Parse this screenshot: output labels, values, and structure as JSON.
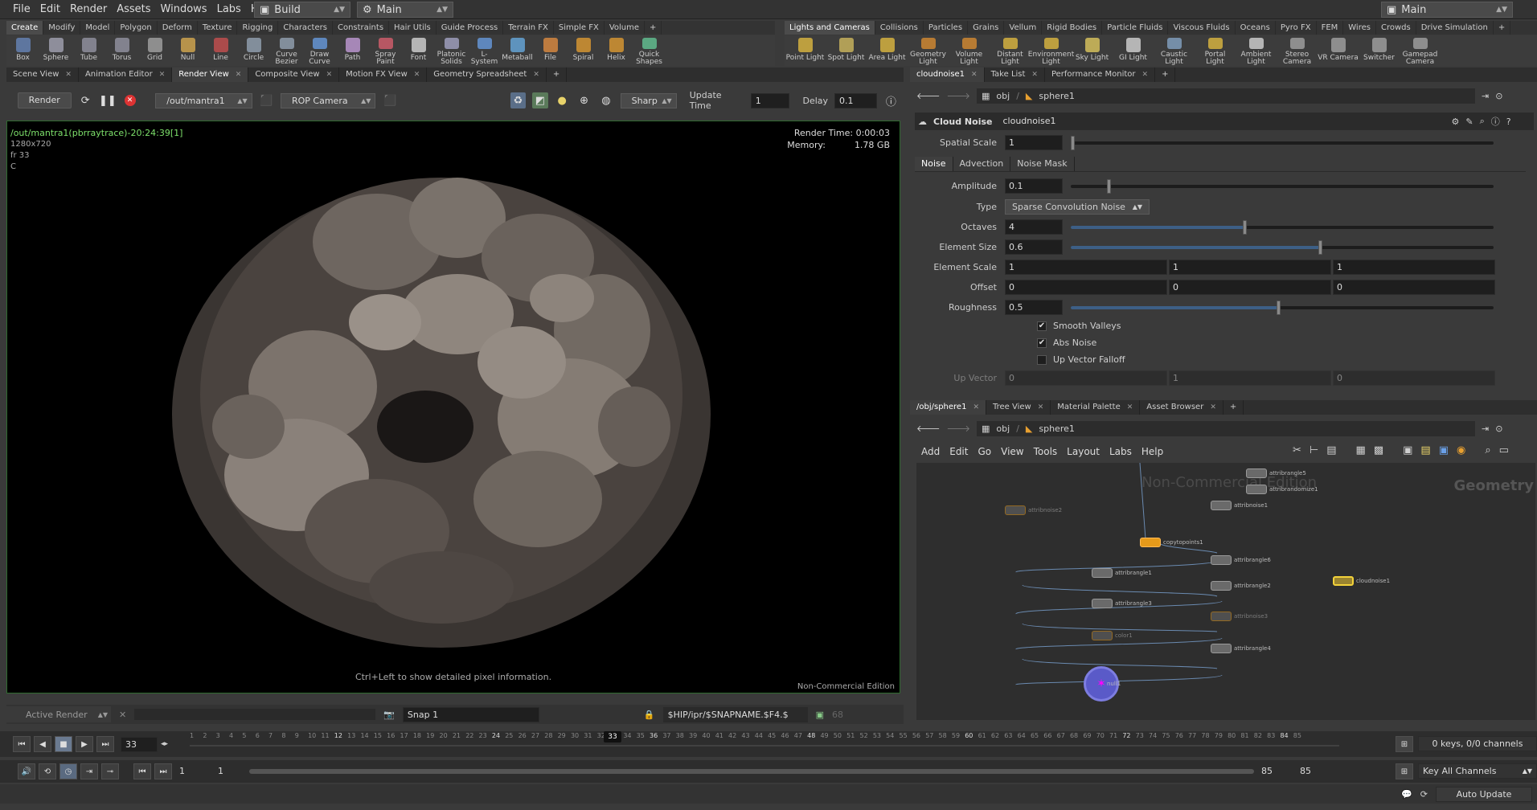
{
  "menu": [
    "File",
    "Edit",
    "Render",
    "Assets",
    "Windows",
    "Labs",
    "Help"
  ],
  "desktop": {
    "left_label": "Build",
    "right_label": "Main",
    "far_right_label": "Main"
  },
  "shelf_left": {
    "tabs": [
      "Create",
      "Modify",
      "Model",
      "Polygon",
      "Deform",
      "Texture",
      "Rigging",
      "Characters",
      "Constraints",
      "Hair Utils",
      "Guide Process",
      "Terrain FX",
      "Simple FX",
      "Volume"
    ],
    "tools": [
      "Box",
      "Sphere",
      "Tube",
      "Torus",
      "Grid",
      "Null",
      "Line",
      "Circle",
      "Curve Bezier",
      "Draw Curve",
      "Path",
      "Spray Paint",
      "Font",
      "Platonic Solids",
      "L-System",
      "Metaball",
      "File",
      "Spiral",
      "Helix",
      "Quick Shapes"
    ]
  },
  "shelf_right": {
    "tabs": [
      "Lights and Cameras",
      "Collisions",
      "Particles",
      "Grains",
      "Vellum",
      "Rigid Bodies",
      "Particle Fluids",
      "Viscous Fluids",
      "Oceans",
      "Pyro FX",
      "FEM",
      "Wires",
      "Crowds",
      "Drive Simulation"
    ],
    "tools": [
      "Point Light",
      "Spot Light",
      "Area Light",
      "Geometry Light",
      "Volume Light",
      "Distant Light",
      "Environment Light",
      "Sky Light",
      "GI Light",
      "Caustic Light",
      "Portal Light",
      "Ambient Light",
      "Stereo Camera",
      "VR Camera",
      "Switcher",
      "Gamepad Camera"
    ]
  },
  "left_pane_tabs": [
    "Scene View",
    "Animation Editor",
    "Render View",
    "Composite View",
    "Motion FX View",
    "Geometry Spreadsheet"
  ],
  "render_toolbar": {
    "render_button": "Render",
    "rop_path": "/out/mantra1",
    "camera": "ROP Camera",
    "quality": "Sharp",
    "update_time_label": "Update Time",
    "update_time_value": "1",
    "delay_label": "Delay",
    "delay_value": "0.1"
  },
  "viewport": {
    "title": "/out/mantra1(pbrraytrace)-20:24:39[1]",
    "resolution": "1280x720",
    "frame": "fr 33",
    "channel": "C",
    "render_time": "Render Time: 0:00:03",
    "memory_label": "Memory:",
    "memory_value": "1.78 GB",
    "hint": "Ctrl+Left to show detailed pixel information.",
    "edition": "Non-Commercial Edition"
  },
  "render_status": {
    "active_render": "Active Render",
    "snap": "Snap 1",
    "path": "$HIP/ipr/$SNAPNAME.$F4.$",
    "count": "68"
  },
  "param_pane": {
    "tabs": [
      "cloudnoise1",
      "Take List",
      "Performance Monitor"
    ],
    "path": [
      "obj",
      "sphere1"
    ],
    "node_type": "Cloud Noise",
    "node_name": "cloudnoise1",
    "spatial_scale": {
      "label": "Spatial Scale",
      "value": "1",
      "level": 0
    },
    "subtabs": [
      "Noise",
      "Advection",
      "Noise Mask"
    ],
    "amplitude": {
      "label": "Amplitude",
      "value": "0.1",
      "level": 0.09
    },
    "type": {
      "label": "Type",
      "value": "Sparse Convolution Noise"
    },
    "octaves": {
      "label": "Octaves",
      "value": "4",
      "level": 0.41
    },
    "element_size": {
      "label": "Element Size",
      "value": "0.6",
      "level": 0.59
    },
    "element_scale": {
      "label": "Element Scale",
      "values": [
        "1",
        "1",
        "1"
      ]
    },
    "offset": {
      "label": "Offset",
      "values": [
        "0",
        "0",
        "0"
      ]
    },
    "roughness": {
      "label": "Roughness",
      "value": "0.5",
      "level": 0.49
    },
    "smooth_valleys": "Smooth Valleys",
    "abs_noise": "Abs Noise",
    "up_vector_falloff": "Up Vector Falloff",
    "up_vector": {
      "label": "Up Vector",
      "values": [
        "0",
        "1",
        "0"
      ]
    }
  },
  "network_pane": {
    "tabs": [
      "/obj/sphere1",
      "Tree View",
      "Material Palette",
      "Asset Browser"
    ],
    "path": [
      "obj",
      "sphere1"
    ],
    "menu": [
      "Add",
      "Edit",
      "Go",
      "View",
      "Tools",
      "Layout",
      "Labs",
      "Help"
    ],
    "watermark": "Non-Commercial Edition",
    "context": "Geometry",
    "nodes": [
      "attribrangle5",
      "attribrandomize1",
      "attribnoise1",
      "attribnoise2",
      "copytopoints1",
      "attribrangle6",
      "attribrangle1",
      "attribrangle2",
      "cloudnoise1",
      "attribrangle3",
      "attribnoise3",
      "color1",
      "attribrangle4",
      "null1"
    ]
  },
  "timeline": {
    "frame": "33",
    "current": "33",
    "start": "1",
    "range_start": "1",
    "range_end": "85",
    "end": "85",
    "ticks": [
      "1",
      "2",
      "3",
      "4",
      "5",
      "6",
      "7",
      "8",
      "9",
      "10",
      "11",
      "12",
      "13",
      "14",
      "15",
      "16",
      "17",
      "18",
      "19",
      "20",
      "21",
      "22",
      "23",
      "24",
      "25",
      "26",
      "27",
      "28",
      "29",
      "30",
      "31",
      "32",
      "33",
      "34",
      "35",
      "36",
      "37",
      "38",
      "39",
      "40",
      "41",
      "42",
      "43",
      "44",
      "45",
      "46",
      "47",
      "48",
      "49",
      "50",
      "51",
      "52",
      "53",
      "54",
      "55",
      "56",
      "57",
      "58",
      "59",
      "60",
      "61",
      "62",
      "63",
      "64",
      "65",
      "66",
      "67",
      "68",
      "69",
      "70",
      "71",
      "72",
      "73",
      "74",
      "75",
      "76",
      "77",
      "78",
      "79",
      "80",
      "81",
      "82",
      "83",
      "84",
      "85"
    ],
    "keys_label": "0 keys, 0/0 channels",
    "key_all": "Key All Channels",
    "auto_update": "Auto Update"
  },
  "colors": {
    "render_title": "#7de06b",
    "accent_blue": "#3d5f86",
    "node_orange": "#e69a1a",
    "node_selected": "#f3d23a"
  }
}
